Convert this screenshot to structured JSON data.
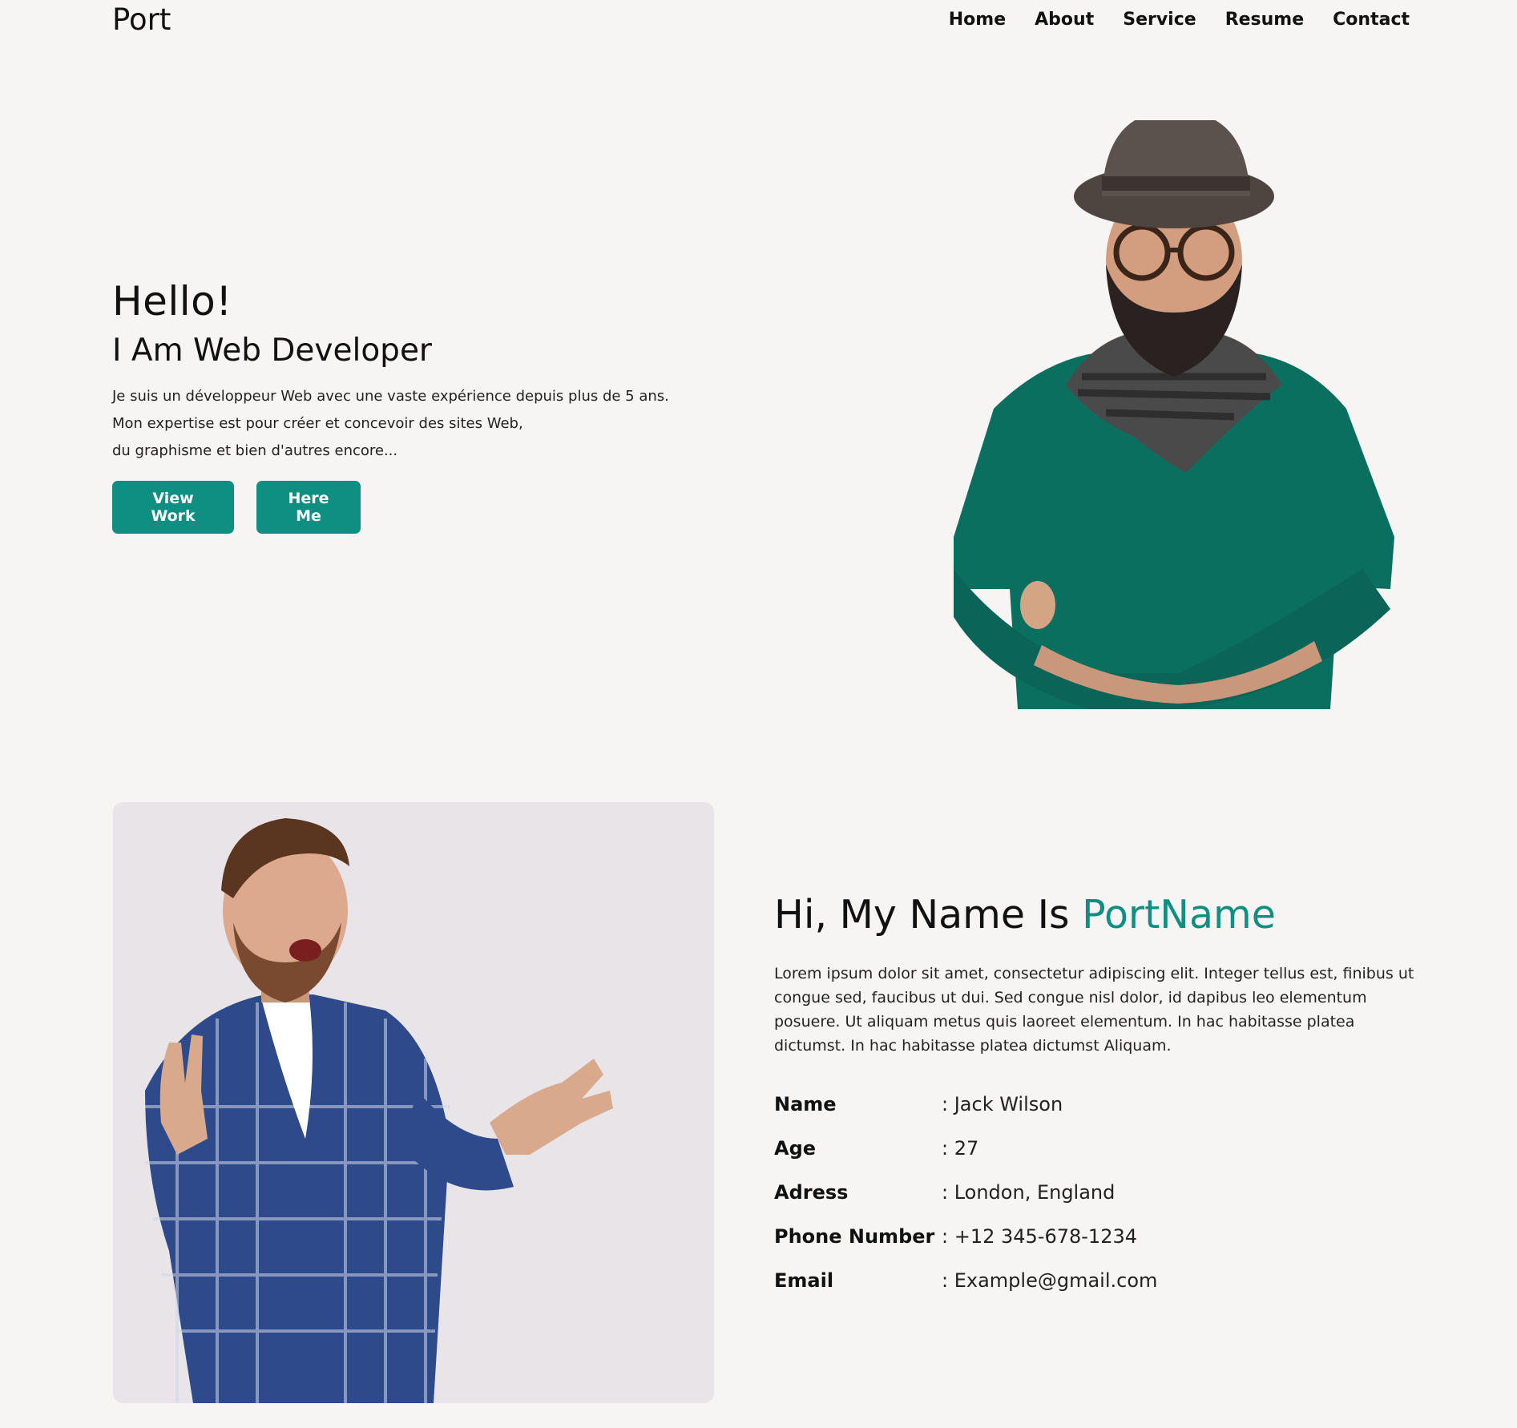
{
  "header": {
    "brand": "Port",
    "nav": [
      "Home",
      "About",
      "Service",
      "Resume",
      "Contact"
    ]
  },
  "hero": {
    "greeting": "Hello!",
    "subtitle": "I Am Web Developer",
    "description_lines": [
      "Je suis un développeur Web avec une vaste expérience depuis plus de 5 ans.",
      "Mon expertise est pour créer et concevoir des sites Web,",
      "du graphisme et bien d'autres encore..."
    ],
    "buttons": {
      "view_work": "View Work",
      "here_me": "Here Me"
    }
  },
  "about": {
    "title_prefix": "Hi, My Name Is ",
    "title_accent": "PortName",
    "description": "Lorem ipsum dolor sit amet, consectetur adipiscing elit. Integer tellus est, finibus ut congue sed, faucibus ut dui. Sed congue nisl dolor, id dapibus leo elementum posuere. Ut aliquam metus quis laoreet elementum. In hac habitasse platea dictumst. In hac habitasse platea dictumst Aliquam.",
    "info": [
      {
        "label": "Name",
        "value": ": Jack Wilson"
      },
      {
        "label": "Age",
        "value": ": 27"
      },
      {
        "label": "Adress",
        "value": ": London, England"
      },
      {
        "label": "Phone Number",
        "value": ": +12 345-678-1234"
      },
      {
        "label": "Email",
        "value": ": Example@gmail.com"
      }
    ]
  },
  "colors": {
    "accent": "#0f8f82",
    "background": "#f6f5f3",
    "card_background": "#e9e4e8"
  }
}
